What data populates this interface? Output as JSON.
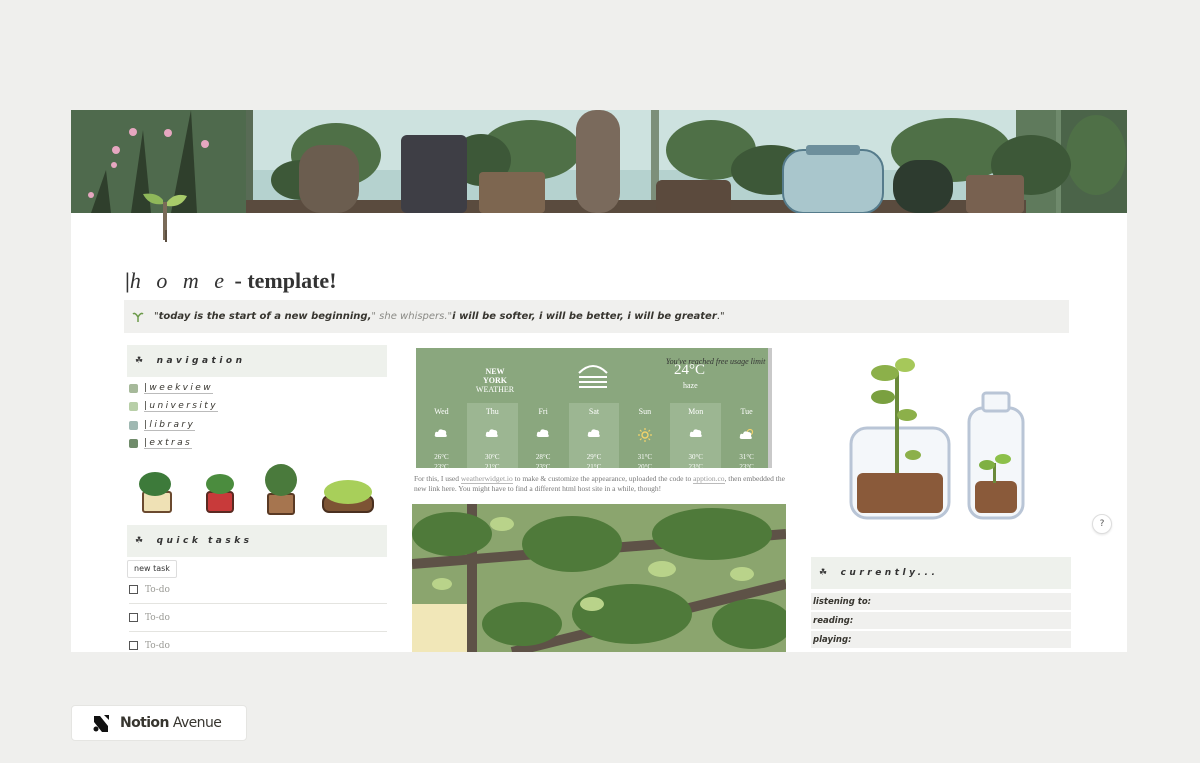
{
  "title": {
    "prefix": "|",
    "main": "h o m e",
    "suffix": " - template!"
  },
  "quote": {
    "open": "\"",
    "part1": "today is the start of a new beginning,",
    "mid": "\" she whispers.\"",
    "part2": "i will be softer, i will be better, i will be greater",
    "close": ".\""
  },
  "navigation": {
    "heading": "navigation",
    "links": [
      {
        "label": "|weekview",
        "color": "#a6b99a"
      },
      {
        "label": "|university",
        "color": "#b8cfa8"
      },
      {
        "label": "|library",
        "color": "#9fb8b2"
      },
      {
        "label": "|extras",
        "color": "#6f8b6a"
      }
    ]
  },
  "quick_tasks": {
    "heading": "quick tasks",
    "new_task_label": "new task",
    "items": [
      "To-do",
      "To-do",
      "To-do"
    ]
  },
  "weather": {
    "city": "NEW YORK",
    "label": "WEATHER",
    "limit_text": "You've reached free usage limit !",
    "temp": "24°C",
    "condition": "haze",
    "days": [
      {
        "name": "Wed",
        "icon": "cloud-icon",
        "hi": "26°C",
        "lo": "23°C"
      },
      {
        "name": "Thu",
        "icon": "cloud-icon",
        "hi": "30°C",
        "lo": "21°C"
      },
      {
        "name": "Fri",
        "icon": "cloud-icon",
        "hi": "28°C",
        "lo": "23°C"
      },
      {
        "name": "Sat",
        "icon": "cloud-icon",
        "hi": "29°C",
        "lo": "21°C"
      },
      {
        "name": "Sun",
        "icon": "sun-icon",
        "hi": "31°C",
        "lo": "20°C"
      },
      {
        "name": "Mon",
        "icon": "cloud-icon",
        "hi": "30°C",
        "lo": "23°C"
      },
      {
        "name": "Tue",
        "icon": "partly-cloudy-icon",
        "hi": "31°C",
        "lo": "23°C"
      }
    ]
  },
  "weather_note": {
    "t1": "For this, I used ",
    "link1": "weatherwidget.io",
    "t2": " to make & customize the appearance,  uploaded the code to ",
    "link2": "apption.co",
    "t3": ", then embedded the new link here. You might have to find a different html host site in a while, though!"
  },
  "help_label": "?",
  "currently": {
    "heading": "currently...",
    "rows": [
      "listening to:",
      "reading:",
      "playing:"
    ]
  },
  "brand": {
    "bold": "Notion",
    "rest": "Avenue"
  },
  "colors": {
    "sage": "#8aa77e",
    "callout_bg": "#eef1ec",
    "quote_bg": "#f0f0ee"
  }
}
